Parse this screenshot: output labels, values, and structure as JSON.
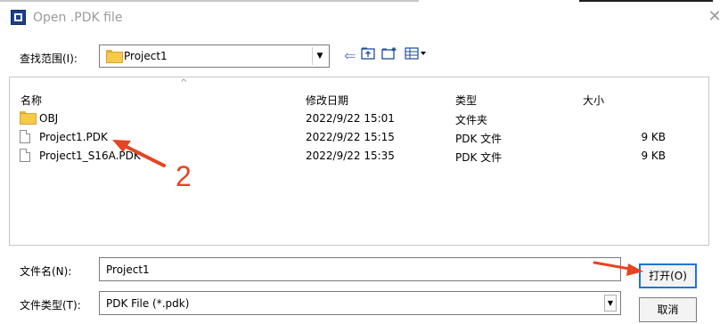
{
  "window": {
    "title": "Open .PDK file"
  },
  "look_in": {
    "label": "查找范围(I):",
    "value": "Project1"
  },
  "columns": {
    "name": "名称",
    "date": "修改日期",
    "type": "类型",
    "size": "大小"
  },
  "files": [
    {
      "icon": "folder-icon",
      "name": "OBJ",
      "date": "2022/9/22 15:01",
      "type": "文件夹",
      "size": ""
    },
    {
      "icon": "document-icon",
      "name": "Project1.PDK",
      "date": "2022/9/22 15:15",
      "type": "PDK 文件",
      "size": "9 KB"
    },
    {
      "icon": "document-icon",
      "name": "Project1_S16A.PDK",
      "date": "2022/9/22 15:35",
      "type": "PDK 文件",
      "size": "9 KB"
    }
  ],
  "filename": {
    "label": "文件名(N):",
    "value": "Project1"
  },
  "filetype": {
    "label": "文件类型(T):",
    "value": "PDK File (*.pdk)"
  },
  "buttons": {
    "open": "打开(O)",
    "cancel": "取消"
  },
  "annotation": {
    "number": "2",
    "color": "#e64422"
  }
}
